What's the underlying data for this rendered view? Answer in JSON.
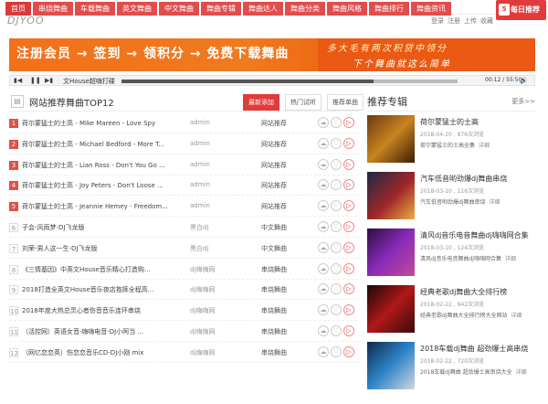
{
  "nav": {
    "items": [
      "首页",
      "串烧舞曲",
      "车载舞曲",
      "英文舞曲",
      "中文舞曲",
      "舞曲专辑",
      "舞曲达人",
      "舞曲分类",
      "舞曲风格",
      "舞曲排行",
      "舞曲资讯"
    ],
    "badge_num": "5",
    "badge_text": "每日推荐"
  },
  "header": {
    "logo": "DJYOO",
    "links": [
      "登录",
      "注册",
      "上传",
      "收藏"
    ]
  },
  "banner": {
    "left": "注册会员  →  签到  →  领积分  →  免费下载舞曲",
    "right_line1": "多大毛有两次积贷中领分",
    "right_line2": "下个舞曲就这么简单"
  },
  "player": {
    "track_title": "文House超嗨打碟",
    "time": "00:12 / 55:50",
    "progress": 0.75
  },
  "list": {
    "title": "网站推荐舞曲TOP12",
    "tabs": [
      "最新添加",
      "热门试听",
      "推荐单曲"
    ],
    "songs": [
      {
        "num": "1",
        "name": "荷尔蒙猛士的士高 - Mike Mareen - Love Spy",
        "source": "admin",
        "category": "网站推荐"
      },
      {
        "num": "2",
        "name": "荷尔蒙猛士的士高 - Michael Bedford - More T...",
        "source": "admin",
        "category": "网站推荐"
      },
      {
        "num": "3",
        "name": "荷尔蒙猛士的士高 - Lian Ross - Don't You Go ...",
        "source": "admin",
        "category": "网站推荐"
      },
      {
        "num": "4",
        "name": "荷尔蒙猛士的士高 - Joy Peters - Don't Loose ...",
        "source": "admin",
        "category": "网站推荐"
      },
      {
        "num": "5",
        "name": "荷尔蒙猛士的士高 - Jeannie Hemey - Freedom...",
        "source": "admin",
        "category": "网站推荐"
      },
      {
        "num": "6",
        "name": "子会-风雨梦-DJ飞龙版",
        "source": "黑白dj",
        "category": "中文舞曲"
      },
      {
        "num": "7",
        "name": "刘荣-男人这一生-DJ飞龙版",
        "source": "黑白dj",
        "category": "中文舞曲"
      },
      {
        "num": "8",
        "name": "《三情基因》中英文House音乐精心打造购...",
        "source": "dj嗨嗨网",
        "category": "串烧舞曲"
      },
      {
        "num": "9",
        "name": "2018打造全英文House音乐夜店抱摔全程高...",
        "source": "dj嗨嗨网",
        "category": "串烧舞曲"
      },
      {
        "num": "10",
        "name": "2018年度大热总灵心者伤音音乐连环串烧",
        "source": "dj嗨嗨网",
        "category": "串烧舞曲"
      },
      {
        "num": "11",
        "name": "（活控网）英语女音·嗨嗨电音-DJ小阿当 ...",
        "source": "dj嗨嗨网",
        "category": "串烧舞曲"
      },
      {
        "num": "12",
        "name": "（网亿恋恋英）伤恋恋音乐CD-DJ小刚 mix",
        "source": "dj嗨嗨网",
        "category": "串烧舞曲"
      }
    ]
  },
  "sidebar": {
    "title": "推荐专辑",
    "more": "更多>>",
    "detail": "详细",
    "albums": [
      {
        "title": "荷尔蒙猛士的士高",
        "meta": "2018-04-20 , 876次浏览",
        "desc": "荷尔蒙猛士的士高全集"
      },
      {
        "title": "汽车低音哟劲爆dj舞曲串烧",
        "meta": "2018-03-10 , 116次浏览",
        "desc": "汽车低音哟劲爆dj舞曲串烧"
      },
      {
        "title": "清风dj音乐电音舞曲dj嗨嗨网合集",
        "meta": "2018-03-10 , 124次浏览",
        "desc": "清风dj音乐电音舞曲dj嗨嗨网合集"
      },
      {
        "title": "经典老歌dj舞曲大全排行榜",
        "meta": "2018-02-22 , 942次浏览",
        "desc": "经典老歌dj舞曲大全排行榜大全网站"
      },
      {
        "title": "2018车载dj舞曲 超劲爆士高串烧",
        "meta": "2018-02-22 , 720次浏览",
        "desc": "2018车载dj舞曲 超劲爆士高串烧大全"
      }
    ]
  }
}
